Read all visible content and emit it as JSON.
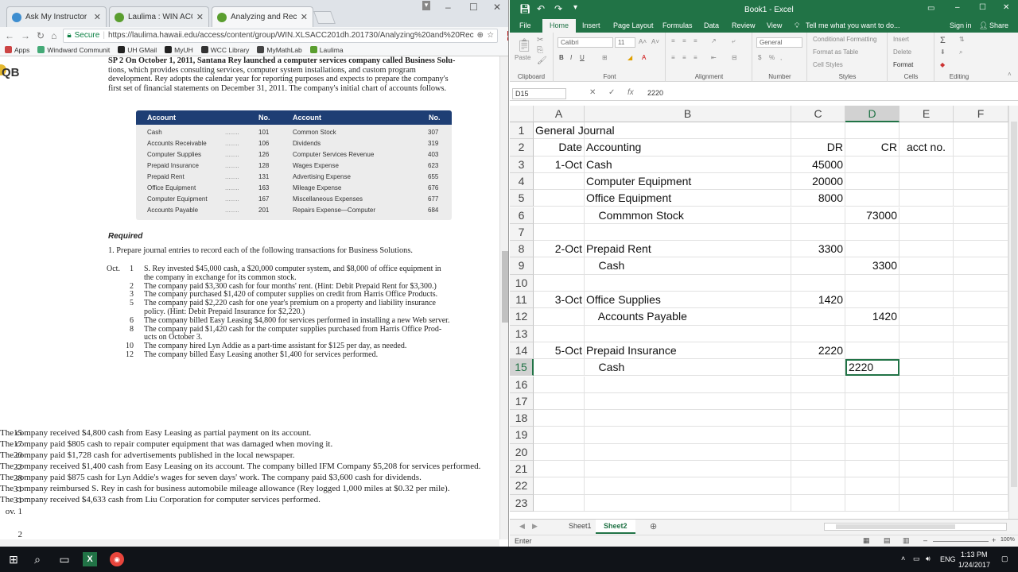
{
  "browser": {
    "tabs": [
      {
        "label": "Ask My Instructor",
        "icon": "help-icon",
        "color": "#3e8ed0"
      },
      {
        "label": "Laulima : WIN ACC-201",
        "icon": "leaf-icon",
        "color": "#5a9e2f"
      },
      {
        "label": "Analyzing and Recording",
        "icon": "leaf-icon",
        "color": "#5a9e2f"
      }
    ],
    "secure_label": "Secure",
    "url": "https://laulima.hawaii.edu/access/content/group/WIN.XLSACC201dh.201730/Analyzing%20and%20Rec",
    "bookmarks": [
      {
        "label": "Apps",
        "color": "#c44"
      },
      {
        "label": "Windward Communit",
        "color": "#4a7"
      },
      {
        "label": "UH GMail",
        "color": "#222"
      },
      {
        "label": "MyUH",
        "color": "#222"
      },
      {
        "label": "WCC Library",
        "color": "#333"
      },
      {
        "label": "MyMathLab",
        "color": "#444"
      },
      {
        "label": "Laulima",
        "color": "#5a9e2f"
      }
    ]
  },
  "textbook": {
    "badge": "QB",
    "intro_lines": [
      "SP 2   On October 1, 2011, Santana Rey launched a computer services company called Business Solu-",
      "tions, which provides consulting services, computer system installations, and custom program",
      "development. Rey adopts the calendar year for reporting purposes and expects to prepare the company's",
      "first set of financial statements on December 31, 2011. The company's initial chart of accounts follows."
    ],
    "table_headers": {
      "account": "Account",
      "no": "No."
    },
    "accounts_left": [
      {
        "name": "Cash",
        "no": "101"
      },
      {
        "name": "Accounts Receivable",
        "no": "106"
      },
      {
        "name": "Computer Supplies",
        "no": "126"
      },
      {
        "name": "Prepaid Insurance",
        "no": "128"
      },
      {
        "name": "Prepaid Rent",
        "no": "131"
      },
      {
        "name": "Office Equipment",
        "no": "163"
      },
      {
        "name": "Computer Equipment",
        "no": "167"
      },
      {
        "name": "Accounts Payable",
        "no": "201"
      }
    ],
    "accounts_right": [
      {
        "name": "Common Stock",
        "no": "307"
      },
      {
        "name": "Dividends",
        "no": "319"
      },
      {
        "name": "Computer Services Revenue",
        "no": "403"
      },
      {
        "name": "Wages Expense",
        "no": "623"
      },
      {
        "name": "Advertising Expense",
        "no": "655"
      },
      {
        "name": "Mileage Expense",
        "no": "676"
      },
      {
        "name": "Miscellaneous Expenses",
        "no": "677"
      },
      {
        "name": "Repairs Expense—Computer",
        "no": "684"
      }
    ],
    "required_label": "Required",
    "required_text": "1.  Prepare journal entries to record each of the following transactions for Business Solutions.",
    "oct_label": "Oct.",
    "transactions": [
      {
        "day": "1",
        "text": "S. Rey invested $45,000 cash, a $20,000 computer system, and $8,000 of office equipment in"
      },
      {
        "day": "",
        "text": "the company in exchange for its common stock."
      },
      {
        "day": "2",
        "text": "The company paid $3,300 cash for four months' rent. (Hint: Debit Prepaid Rent for $3,300.)"
      },
      {
        "day": "3",
        "text": "The company purchased $1,420 of computer supplies on credit from Harris Office Products."
      },
      {
        "day": "5",
        "text": "The company paid $2,220 cash for one year's premium on a property and liability insurance"
      },
      {
        "day": "",
        "text": "policy. (Hint: Debit Prepaid Insurance for $2,220.)"
      },
      {
        "day": "6",
        "text": "The company billed Easy Leasing $4,800 for services performed in installing a new Web server."
      },
      {
        "day": "8",
        "text": "The company paid $1,420 cash for the computer supplies purchased from Harris Office Prod-"
      },
      {
        "day": "",
        "text": "ucts on October 3."
      },
      {
        "day": "10",
        "text": "The company hired Lyn Addie as a part-time assistant for $125 per day, as needed."
      },
      {
        "day": "12",
        "text": "The company billed Easy Leasing another $1,400 for services performed."
      }
    ],
    "transactions2": [
      {
        "day": "15",
        "text": "The company received $4,800 cash from Easy Leasing as partial payment on its account."
      },
      {
        "day": "17",
        "text": "The company paid $805 cash to repair computer equipment that was damaged when moving it."
      },
      {
        "day": "20",
        "text": "The company paid $1,728 cash for advertisements published in the local newspaper."
      },
      {
        "day": "22",
        "text": "The company received $1,400 cash from Easy Leasing on its account."
      },
      {
        "day": "28",
        "text": "The company billed IFM Company $5,208 for services performed."
      },
      {
        "day": "31",
        "text": "The company paid $875 cash for Lyn Addie's wages for seven days' work."
      },
      {
        "day": "31",
        "text": "The company paid $3,600 cash for dividends."
      },
      {
        "day": "ov.   1",
        "text": "The company reimbursed S. Rey in cash for business automobile mileage allowance (Rey"
      },
      {
        "day": "",
        "text": "logged 1,000 miles at $0.32 per mile)."
      },
      {
        "day": "2",
        "text": "The company received $4,633 cash from Liu Corporation for computer services performed."
      }
    ]
  },
  "excel": {
    "title": "Book1 - Excel",
    "tell_me": "Tell me what you want to do...",
    "sign_in": "Sign in",
    "share": "Share",
    "menu": [
      "File",
      "Home",
      "Insert",
      "Page Layout",
      "Formulas",
      "Data",
      "Review",
      "View"
    ],
    "ribbon": {
      "paste": "Paste",
      "clipboard": "Clipboard",
      "font_name": "Calibri",
      "font_size": "11",
      "font": "Font",
      "alignment": "Alignment",
      "number_format": "General",
      "number": "Number",
      "conditional": "Conditional Formatting",
      "format_table": "Format as Table",
      "cell_styles": "Cell Styles",
      "styles": "Styles",
      "insert": "Insert",
      "delete": "Delete",
      "format": "Format",
      "cells": "Cells",
      "editing": "Editing"
    },
    "name_box": "D15",
    "formula_value": "2220",
    "columns": [
      "A",
      "B",
      "C",
      "D",
      "E",
      "F"
    ],
    "rows": [
      {
        "n": "1",
        "a": "General Journal",
        "b": "",
        "c": "",
        "d": "",
        "e": ""
      },
      {
        "n": "2",
        "a": "Date",
        "b": "Accounting",
        "c": "DR",
        "d": "CR",
        "e": "acct no."
      },
      {
        "n": "3",
        "a": "1-Oct",
        "b": "Cash",
        "c": "45000",
        "d": "",
        "e": ""
      },
      {
        "n": "4",
        "a": "",
        "b": "Computer Equipment",
        "c": "20000",
        "d": "",
        "e": ""
      },
      {
        "n": "5",
        "a": "",
        "b": "Office Equipment",
        "c": "8000",
        "d": "",
        "e": ""
      },
      {
        "n": "6",
        "a": "",
        "b": "    Commmon Stock",
        "c": "",
        "d": "73000",
        "e": ""
      },
      {
        "n": "7",
        "a": "",
        "b": "",
        "c": "",
        "d": "",
        "e": ""
      },
      {
        "n": "8",
        "a": "2-Oct",
        "b": "Prepaid Rent",
        "c": "3300",
        "d": "",
        "e": ""
      },
      {
        "n": "9",
        "a": "",
        "b": "    Cash",
        "c": "",
        "d": "3300",
        "e": ""
      },
      {
        "n": "10",
        "a": "",
        "b": "",
        "c": "",
        "d": "",
        "e": ""
      },
      {
        "n": "11",
        "a": "3-Oct",
        "b": "Office Supplies",
        "c": "1420",
        "d": "",
        "e": ""
      },
      {
        "n": "12",
        "a": "",
        "b": "    Accounts Payable",
        "c": "",
        "d": "1420",
        "e": ""
      },
      {
        "n": "13",
        "a": "",
        "b": "",
        "c": "",
        "d": "",
        "e": ""
      },
      {
        "n": "14",
        "a": "5-Oct",
        "b": "Prepaid Insurance",
        "c": "2220",
        "d": "",
        "e": ""
      },
      {
        "n": "15",
        "a": "",
        "b": "    Cash",
        "c": "",
        "d": "2220",
        "e": ""
      },
      {
        "n": "16",
        "a": "",
        "b": "",
        "c": "",
        "d": "",
        "e": ""
      },
      {
        "n": "17",
        "a": "",
        "b": "",
        "c": "",
        "d": "",
        "e": ""
      },
      {
        "n": "18",
        "a": "",
        "b": "",
        "c": "",
        "d": "",
        "e": ""
      },
      {
        "n": "19",
        "a": "",
        "b": "",
        "c": "",
        "d": "",
        "e": ""
      },
      {
        "n": "20",
        "a": "",
        "b": "",
        "c": "",
        "d": "",
        "e": ""
      },
      {
        "n": "21",
        "a": "",
        "b": "",
        "c": "",
        "d": "",
        "e": ""
      },
      {
        "n": "22",
        "a": "",
        "b": "",
        "c": "",
        "d": "",
        "e": ""
      },
      {
        "n": "23",
        "a": "",
        "b": "",
        "c": "",
        "d": "",
        "e": ""
      }
    ],
    "sheets": [
      "Sheet1",
      "Sheet2"
    ],
    "active_sheet": "Sheet2",
    "status": "Enter",
    "zoom": "100%",
    "accent": "#217346"
  },
  "taskbar": {
    "lang": "ENG",
    "time": "1:13 PM",
    "date": "1/24/2017"
  }
}
